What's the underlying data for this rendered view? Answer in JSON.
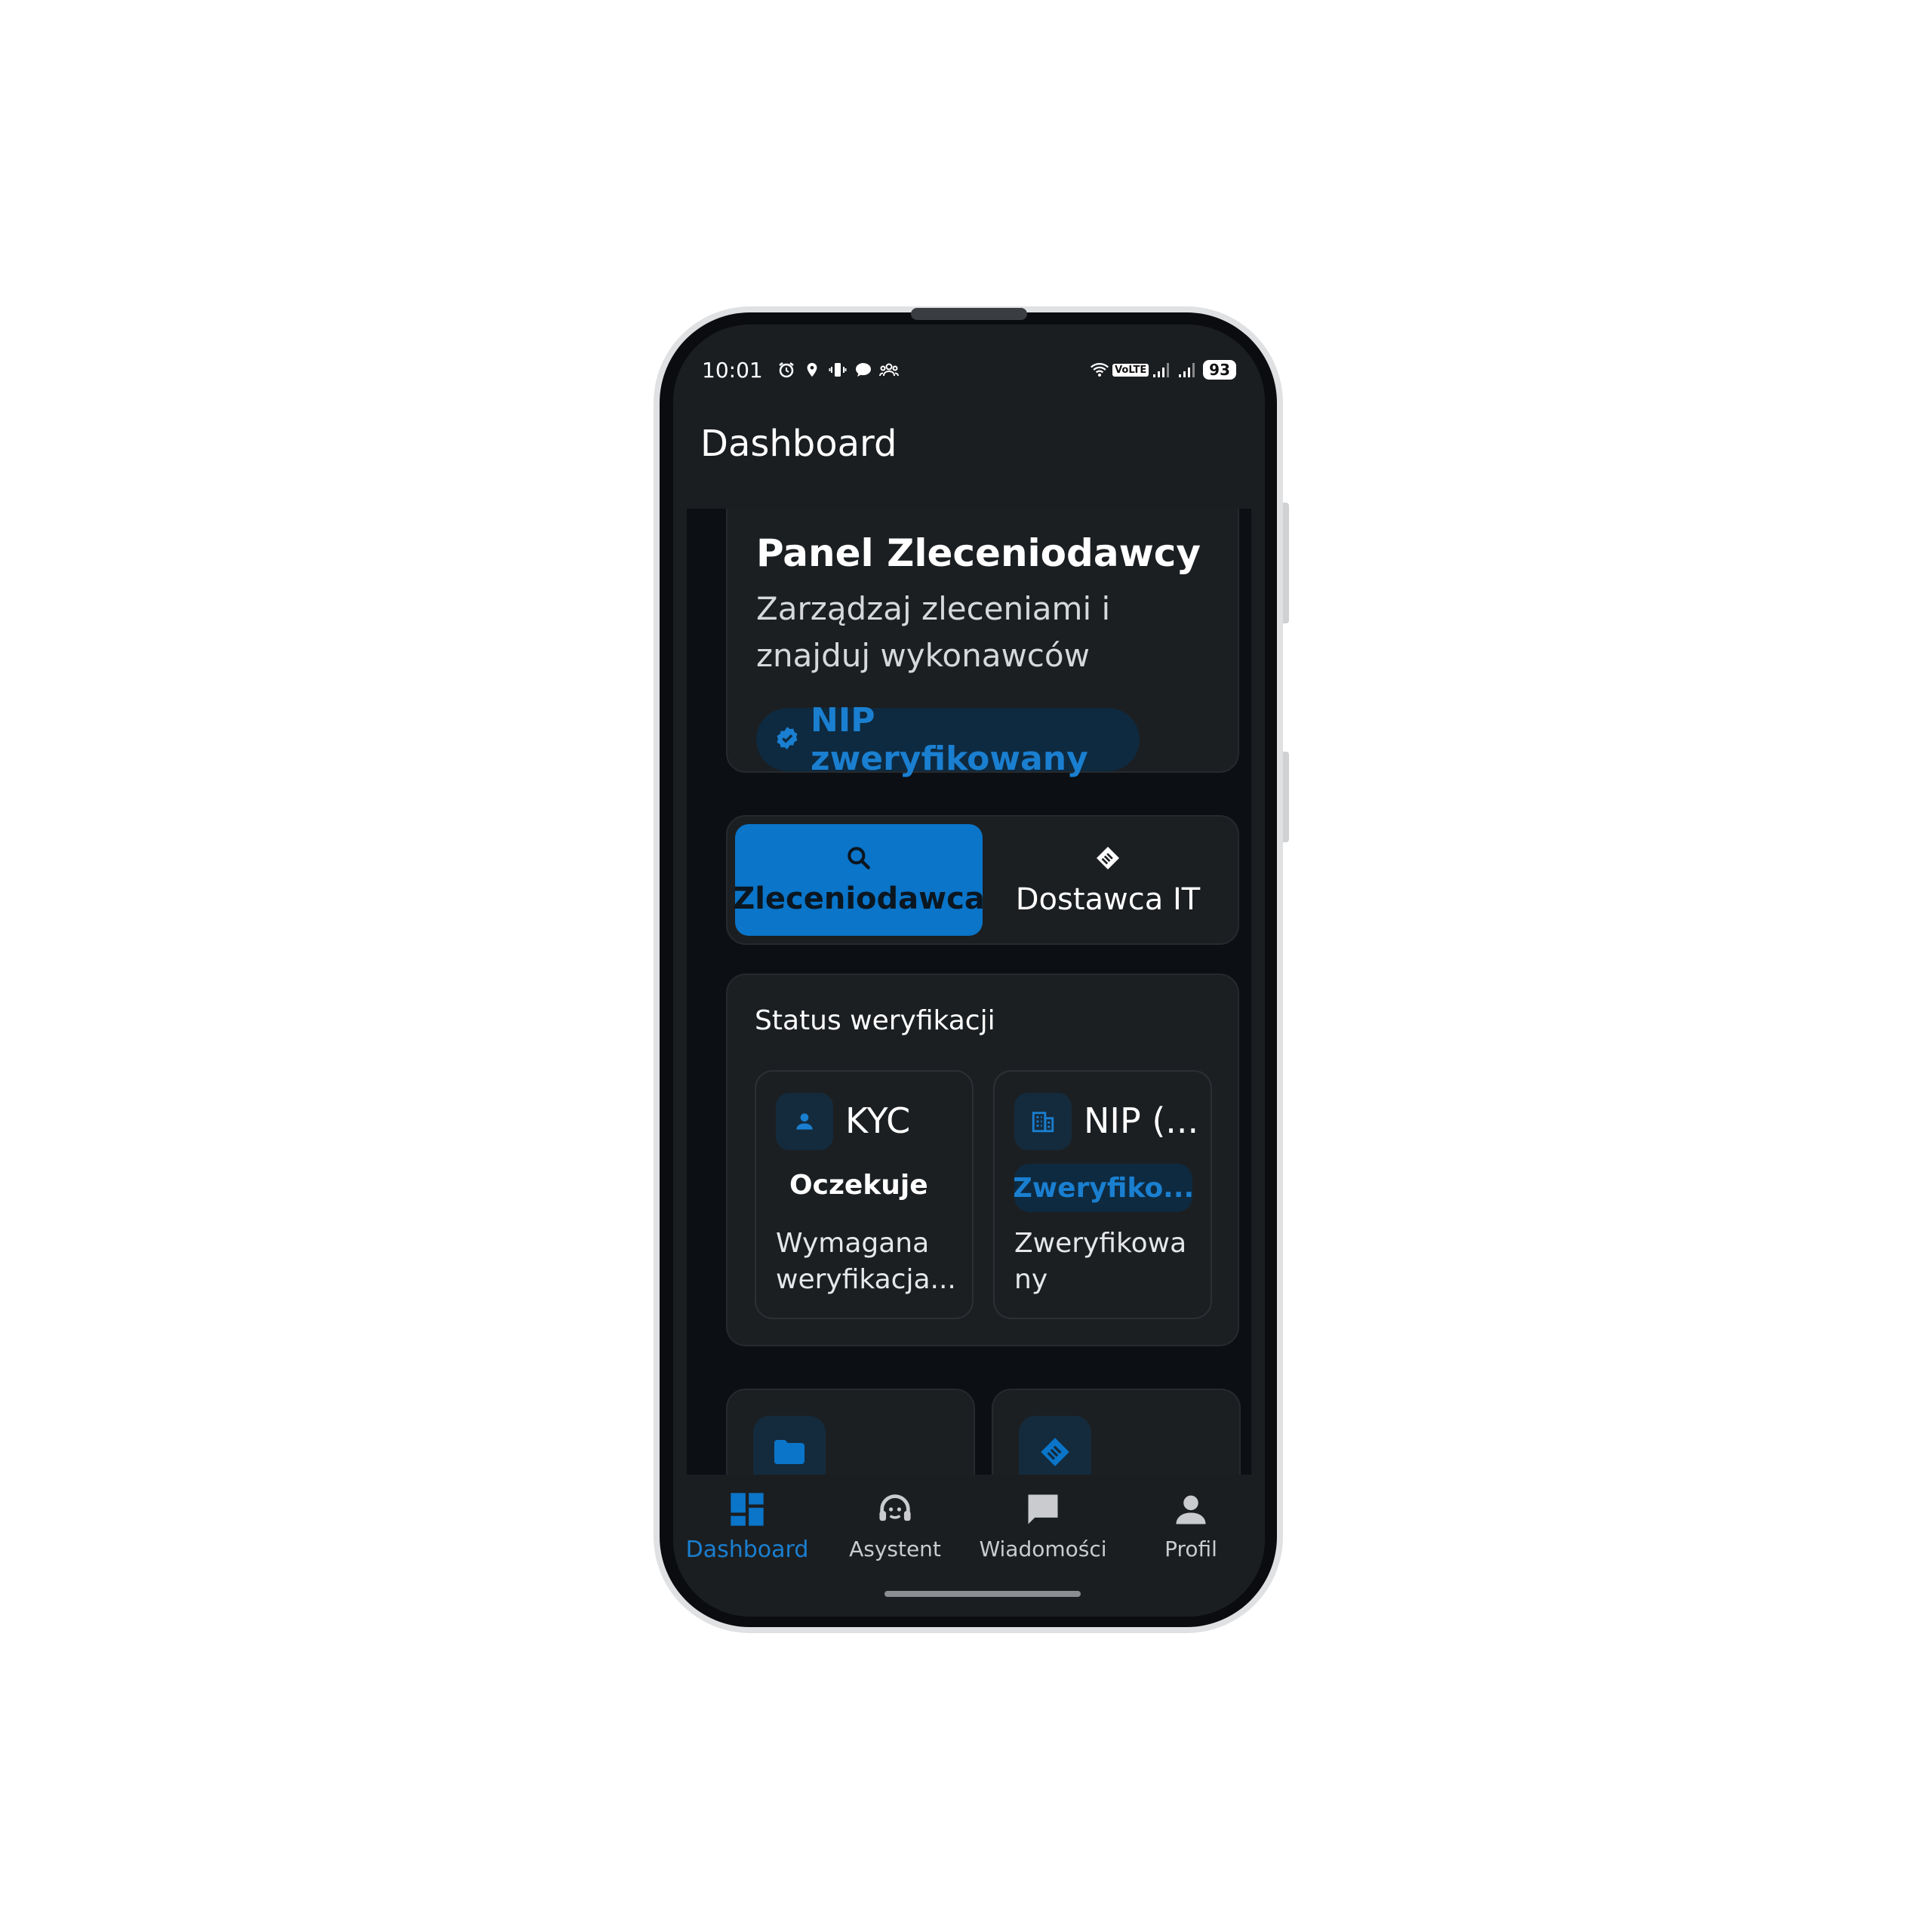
{
  "status_bar": {
    "time": "10:01",
    "battery": "93",
    "left_icons": [
      "alarm-icon",
      "location-icon",
      "vibrate-icon",
      "chat-bubble-icon",
      "group-icon"
    ],
    "right_icons": [
      "wifi-icon",
      "volte-icon",
      "signal-icon",
      "signal-icon"
    ],
    "volte_label": "VoLTE"
  },
  "app_bar": {
    "title": "Dashboard"
  },
  "hero": {
    "title": "Panel Zleceniodawcy",
    "subtitle": "Zarządzaj zleceniami i znajduj wykonawców",
    "badge": "NIP zweryfikowany"
  },
  "role_switch": {
    "options": [
      {
        "label": "Zleceniodawca",
        "icon": "search-icon",
        "active": true
      },
      {
        "label": "Dostawca IT",
        "icon": "handshake-icon",
        "active": false
      }
    ]
  },
  "verification": {
    "title": "Status weryfikacji",
    "items": [
      {
        "name": "KYC",
        "icon": "person-icon",
        "status": "Oczekuje",
        "description": "Wymagana weryfikacja..."
      },
      {
        "name": "NIP (...",
        "icon": "building-icon",
        "status": "Zweryfiko...",
        "description": "Zweryfikowa ny"
      }
    ]
  },
  "tiles": [
    {
      "icon": "folder-icon"
    },
    {
      "icon": "handshake-icon"
    }
  ],
  "bottom_nav": {
    "items": [
      {
        "label": "Dashboard",
        "icon": "dashboard-icon",
        "active": true
      },
      {
        "label": "Asystent",
        "icon": "assistant-icon",
        "active": false
      },
      {
        "label": "Wiadomości",
        "icon": "chat-icon",
        "active": false
      },
      {
        "label": "Profil",
        "icon": "person-icon",
        "active": false
      }
    ]
  },
  "colors": {
    "accent": "#0a75c9",
    "accent_text": "#1a7fd0",
    "background": "#1b1e21",
    "surface": "#1c1f22"
  }
}
